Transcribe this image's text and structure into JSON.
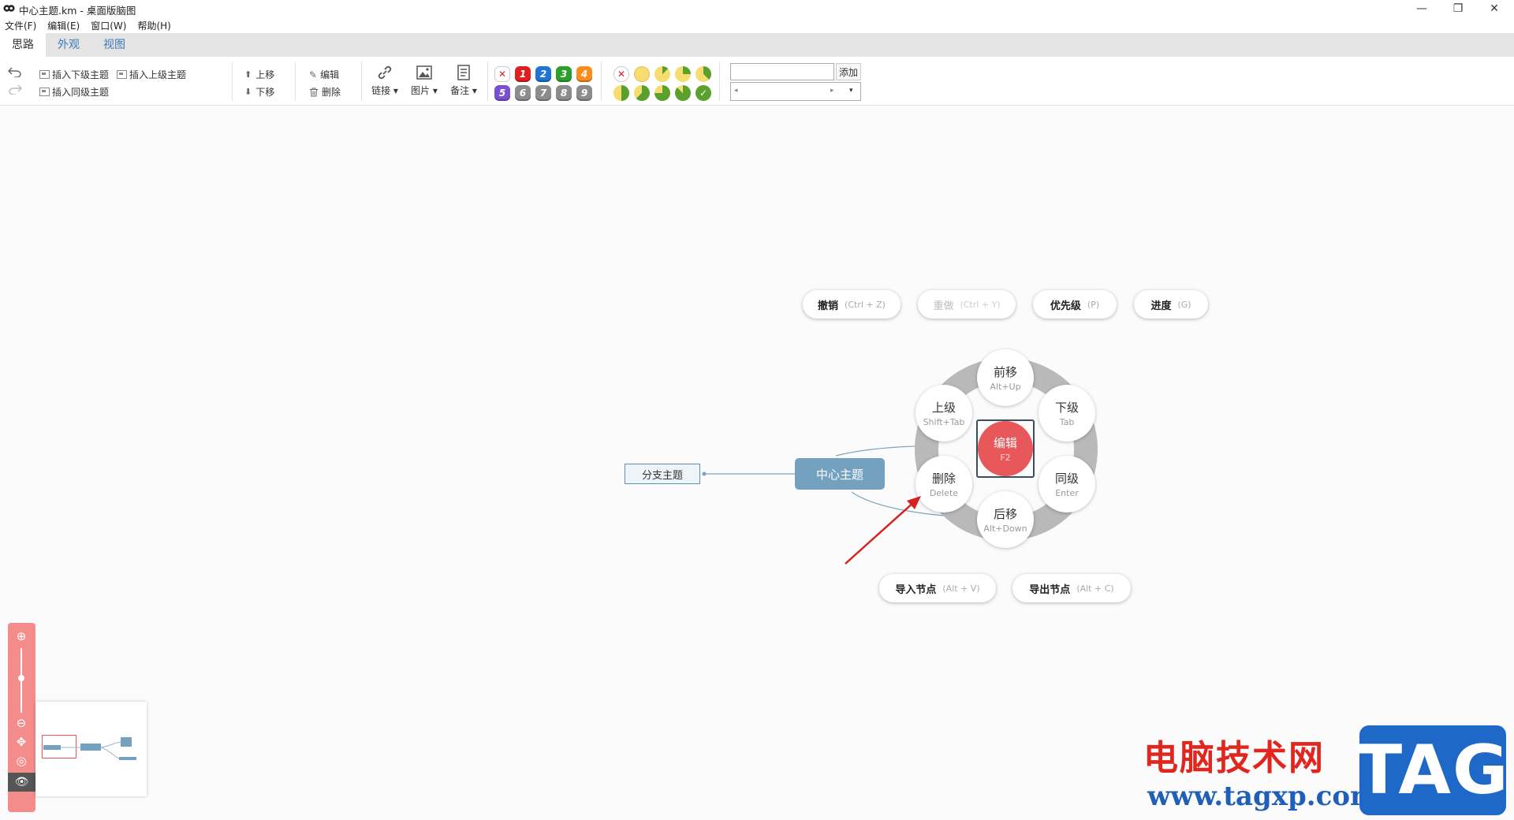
{
  "window": {
    "title": "中心主题.km - 桌面版脑图",
    "minimize": "—",
    "restore": "❐",
    "close": "✕"
  },
  "menu": [
    "文件(F)",
    "编辑(E)",
    "窗口(W)",
    "帮助(H)"
  ],
  "tabs": [
    "思路",
    "外观",
    "视图"
  ],
  "toolbar": {
    "insert_child": "插入下级主题",
    "insert_parent": "插入上级主题",
    "insert_sibling": "插入同级主题",
    "move_up": "上移",
    "move_down": "下移",
    "edit": "编辑",
    "delete": "删除",
    "link": "链接",
    "image": "图片",
    "note": "备注",
    "priorities": [
      "1",
      "2",
      "3",
      "4",
      "5",
      "6",
      "7",
      "8",
      "9"
    ],
    "add": "添加"
  },
  "commands": {
    "undo": {
      "label": "撤销",
      "shortcut": "(Ctrl + Z)"
    },
    "redo": {
      "label": "重做",
      "shortcut": "(Ctrl + Y)"
    },
    "priority": {
      "label": "优先级",
      "shortcut": "(P)"
    },
    "progress": {
      "label": "进度",
      "shortcut": "(G)"
    },
    "import": {
      "label": "导入节点",
      "shortcut": "(Alt + V)"
    },
    "export": {
      "label": "导出节点",
      "shortcut": "(Alt + C)"
    }
  },
  "wheel": {
    "forward": {
      "label": "前移",
      "shortcut": "Alt+Up"
    },
    "child": {
      "label": "下级",
      "shortcut": "Tab"
    },
    "sibling": {
      "label": "同级",
      "shortcut": "Enter"
    },
    "backward": {
      "label": "后移",
      "shortcut": "Alt+Down"
    },
    "delete": {
      "label": "删除",
      "shortcut": "Delete"
    },
    "parent": {
      "label": "上级",
      "shortcut": "Shift+Tab"
    },
    "edit": {
      "label": "编辑",
      "shortcut": "F2"
    }
  },
  "nodes": {
    "center": "中心主题",
    "branch": "分支主题"
  },
  "watermark": {
    "text": "电脑技术网",
    "url": "www.tagxp.com",
    "tag": "TAG"
  },
  "colors": {
    "priority": [
      "#e21f1f",
      "#1f74d6",
      "#2ca02c",
      "#ff8c1a",
      "#7a4fd3",
      "#8c8c8c",
      "#8c8c8c",
      "#8c8c8c",
      "#8c8c8c"
    ],
    "accent": "#e8585a",
    "node": "#73a1bf"
  }
}
